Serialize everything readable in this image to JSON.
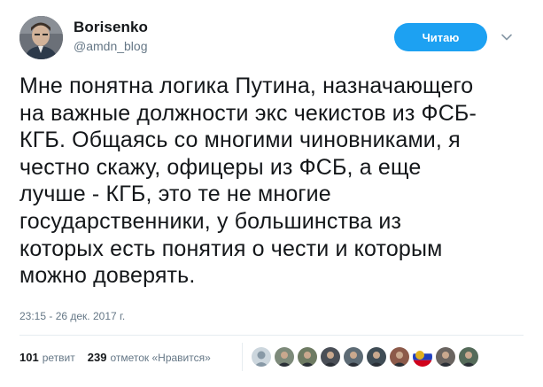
{
  "user": {
    "display_name": "Borisenko",
    "screen_name": "@amdn_blog"
  },
  "follow_button": {
    "label": "Читаю"
  },
  "tweet": {
    "lines": [
      "Мне понятна логика Путина, назначающего",
      "на важные должности экс чекистов из ФСБ-",
      "КГБ. Общаясь со многими чиновниками, я",
      "честно скажу, офицеры из ФСБ, а еще",
      "лучше - КГБ, это те не многие",
      "государственники, у большинства из",
      "которых есть понятия о чести и которым",
      "можно доверять."
    ],
    "timestamp": "23:15 - 26 дек. 2017 г."
  },
  "stats": {
    "retweets_count": "101",
    "retweets_label": "ретвит",
    "likes_count": "239",
    "likes_label": "отметок «Нравится»"
  },
  "likers": [
    {
      "icon": "default-avatar",
      "color": "#8899a6"
    },
    {
      "icon": "user-avatar",
      "color": "#7d8a7a"
    },
    {
      "icon": "user-avatar",
      "color": "#6e7b63"
    },
    {
      "icon": "user-avatar",
      "color": "#4a4f57"
    },
    {
      "icon": "user-avatar",
      "color": "#5d6b75"
    },
    {
      "icon": "user-avatar",
      "color": "#3f4c55"
    },
    {
      "icon": "user-avatar",
      "color": "#8c5a4a"
    },
    {
      "icon": "flag-avatar",
      "color": "#d0021b"
    },
    {
      "icon": "user-avatar",
      "color": "#6a6460"
    },
    {
      "icon": "user-avatar",
      "color": "#556b5a"
    }
  ],
  "colors": {
    "accent": "#1da1f2",
    "secondary_text": "#657786",
    "primary_text": "#14171a"
  }
}
